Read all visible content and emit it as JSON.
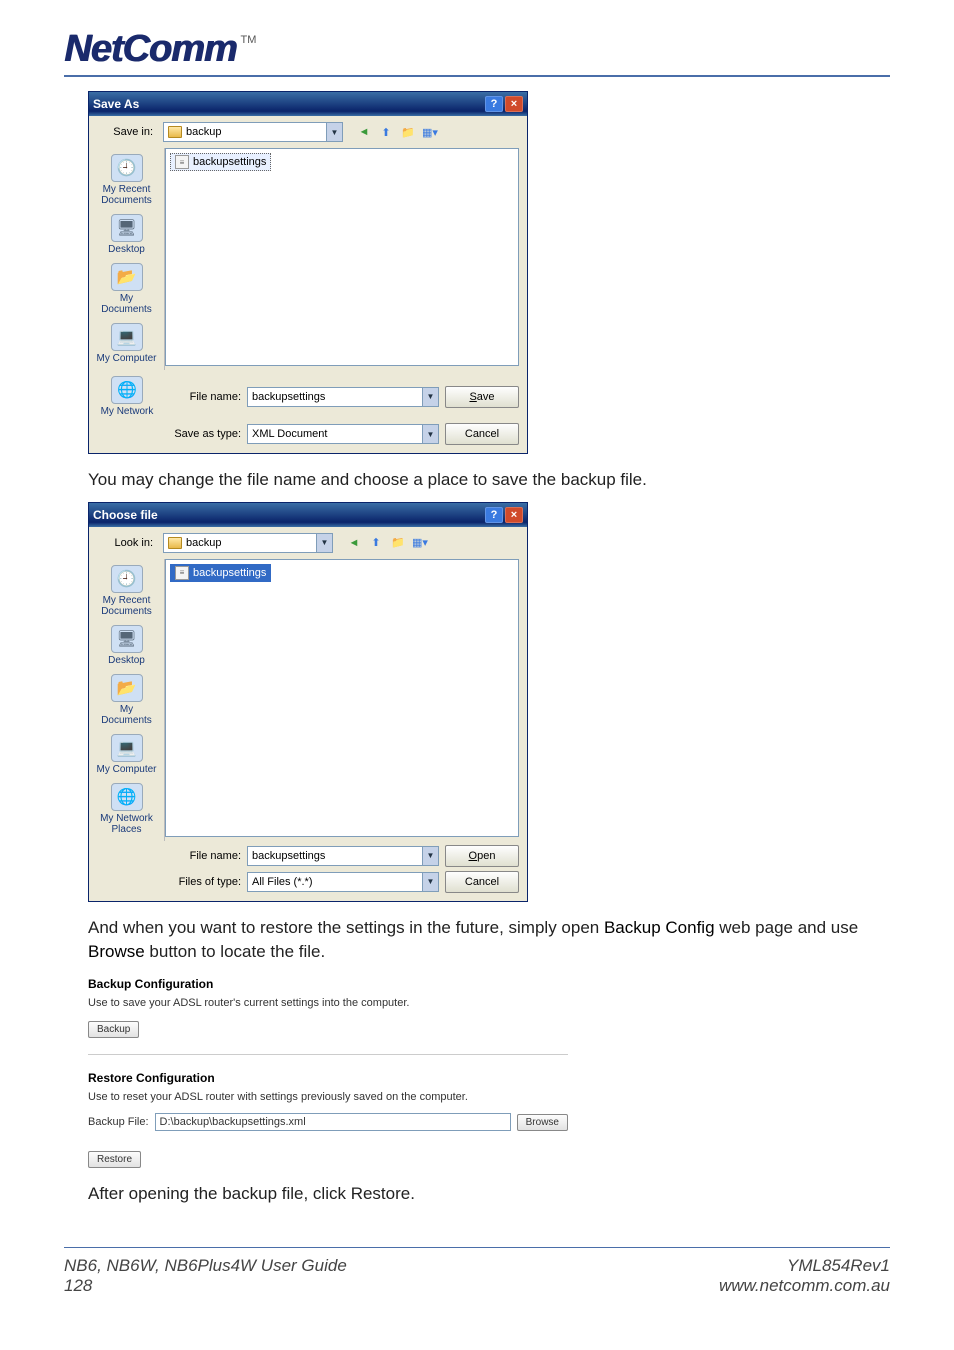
{
  "branding": {
    "logo": "NetComm",
    "tm": "TM"
  },
  "dialogs": {
    "save": {
      "title": "Save As",
      "dir_label": "Save in:",
      "dir_value": "backup",
      "file_shown": "backupsettings",
      "places": [
        "My Recent Documents",
        "Desktop",
        "My Documents",
        "My Computer",
        "My Network"
      ],
      "filename_label": "File name:",
      "filename_value": "backupsettings",
      "type_label": "Save as type:",
      "type_value": "XML Document",
      "ok": "Save",
      "cancel": "Cancel"
    },
    "open": {
      "title": "Choose file",
      "dir_label": "Look in:",
      "dir_value": "backup",
      "file_shown": "backupsettings",
      "places": [
        "My Recent Documents",
        "Desktop",
        "My Documents",
        "My Computer",
        "My Network Places"
      ],
      "filename_label": "File name:",
      "filename_value": "backupsettings",
      "type_label": "Files of type:",
      "type_value": "All Files (*.*)",
      "ok": "Open",
      "cancel": "Cancel"
    }
  },
  "text": {
    "p1": "You may change the file name and choose a place to save the backup file.",
    "p2a": "And when you want to restore the settings in the future, simply open ",
    "p2b": "Backup Config",
    "p2c": " web page and use ",
    "p2d": "Browse",
    "p2e": " button to locate the file.",
    "p3": "After opening the backup file, click Restore."
  },
  "cfg": {
    "backup_h": "Backup Configuration",
    "backup_t": "Use to save your ADSL router's current settings into the computer.",
    "backup_btn": "Backup",
    "restore_h": "Restore Configuration",
    "restore_t": "Use to reset your ADSL router with settings previously saved on the computer.",
    "file_label": "Backup File:",
    "file_value": "D:\\backup\\backupsettings.xml",
    "browse_btn": "Browse",
    "restore_btn": "Restore"
  },
  "footer": {
    "left1": "NB6, NB6W, NB6Plus4W User Guide",
    "left2": "128",
    "right1": "YML854Rev1",
    "right2": "www.netcomm.com.au"
  }
}
